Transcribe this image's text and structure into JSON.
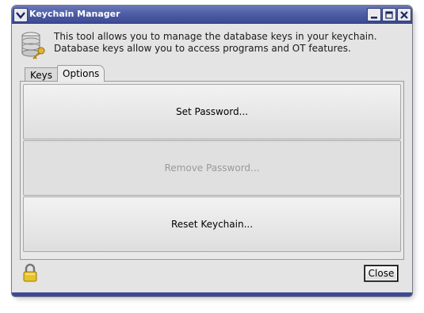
{
  "window": {
    "title": "Keychain Manager",
    "controls": [
      "minimize-icon",
      "maximize-icon",
      "close-icon"
    ]
  },
  "header": {
    "line1": "This tool allows you to manage the database keys in your keychain.",
    "line2": "Database keys allow you to access programs and OT features.",
    "icon": "database-key-icon"
  },
  "tabs": [
    {
      "label": "Keys",
      "active": false
    },
    {
      "label": "Options",
      "active": true
    }
  ],
  "options": {
    "set_password": "Set Password...",
    "remove_password": "Remove Password...",
    "reset_keychain": "Reset Keychain..."
  },
  "footer": {
    "lock_icon": "padlock-icon",
    "close_label": "Close"
  },
  "colors": {
    "titlebar": "#4f5ea7",
    "window_bg": "#e4e4e4",
    "disabled_text": "#9a9a9a"
  }
}
